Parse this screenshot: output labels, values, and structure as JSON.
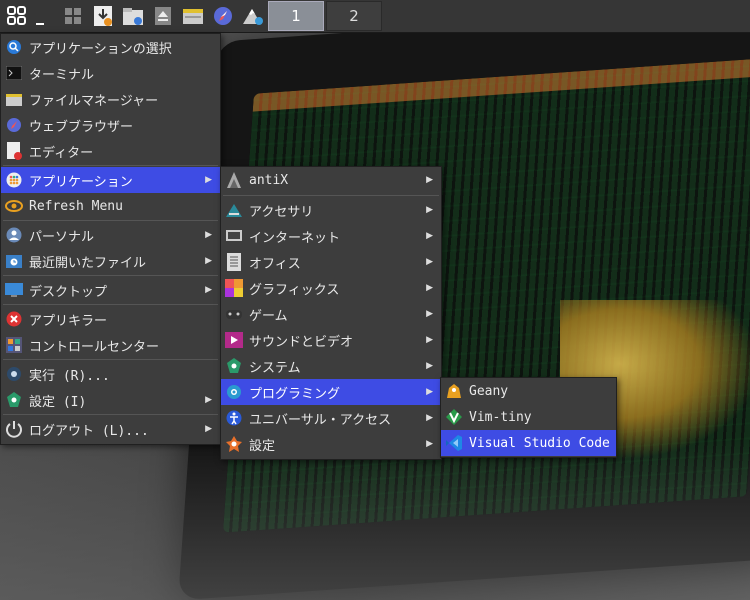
{
  "taskbar": {
    "icons": [
      "start-menu-icon",
      "show-desktop-icon",
      "windows-icon",
      "downloads-icon",
      "file-manager-icon",
      "eject-icon",
      "folder-icon",
      "browser-icon",
      "mountain-icon"
    ],
    "workspaces": [
      "1",
      "2"
    ],
    "active_workspace": "1"
  },
  "main_menu": {
    "items": [
      {
        "label": "アプリケーションの選択",
        "icon": "app-finder-icon"
      },
      {
        "label": "ターミナル",
        "icon": "terminal-icon"
      },
      {
        "label": "ファイルマネージャー",
        "icon": "file-manager-icon"
      },
      {
        "label": "ウェブブラウザー",
        "icon": "browser-icon"
      },
      {
        "label": "エディター",
        "icon": "editor-icon"
      },
      {
        "label": "アプリケーション",
        "icon": "applications-icon",
        "submenu": true
      },
      {
        "label": "Refresh Menu",
        "icon": "refresh-icon"
      },
      {
        "label": "パーソナル",
        "icon": "personal-icon",
        "submenu": true
      },
      {
        "label": "最近開いたファイル",
        "icon": "recent-files-icon",
        "submenu": true
      },
      {
        "label": "デスクトップ",
        "icon": "desktop-icon",
        "submenu": true
      },
      {
        "label": "アプリキラー",
        "icon": "app-killer-icon"
      },
      {
        "label": "コントロールセンター",
        "icon": "control-center-icon"
      },
      {
        "label": "実行 (R)...",
        "icon": "run-icon"
      },
      {
        "label": "設定 (I)",
        "icon": "settings-icon",
        "submenu": true
      },
      {
        "label": "ログアウト (L)...",
        "icon": "logout-icon",
        "submenu": true
      }
    ]
  },
  "apps_menu": {
    "items": [
      {
        "label": "antiX",
        "icon": "antix-icon"
      },
      {
        "label": "アクセサリ",
        "icon": "accessories-icon"
      },
      {
        "label": "インターネット",
        "icon": "internet-icon"
      },
      {
        "label": "オフィス",
        "icon": "office-icon"
      },
      {
        "label": "グラフィックス",
        "icon": "graphics-icon"
      },
      {
        "label": "ゲーム",
        "icon": "games-icon"
      },
      {
        "label": "サウンドとビデオ",
        "icon": "sound-video-icon"
      },
      {
        "label": "システム",
        "icon": "system-icon"
      },
      {
        "label": "プログラミング",
        "icon": "programming-icon"
      },
      {
        "label": "ユニバーサル・アクセス",
        "icon": "accessibility-icon"
      },
      {
        "label": "設定",
        "icon": "settings-icon"
      }
    ]
  },
  "programming_menu": {
    "items": [
      {
        "label": "Geany",
        "icon": "geany-icon"
      },
      {
        "label": "Vim-tiny",
        "icon": "vim-icon"
      },
      {
        "label": "Visual Studio Code",
        "icon": "vscode-icon"
      }
    ]
  },
  "colors": {
    "selection": "#3e4ce4",
    "menu_bg": "#3d3d3d",
    "taskbar_bg": "#363636"
  }
}
